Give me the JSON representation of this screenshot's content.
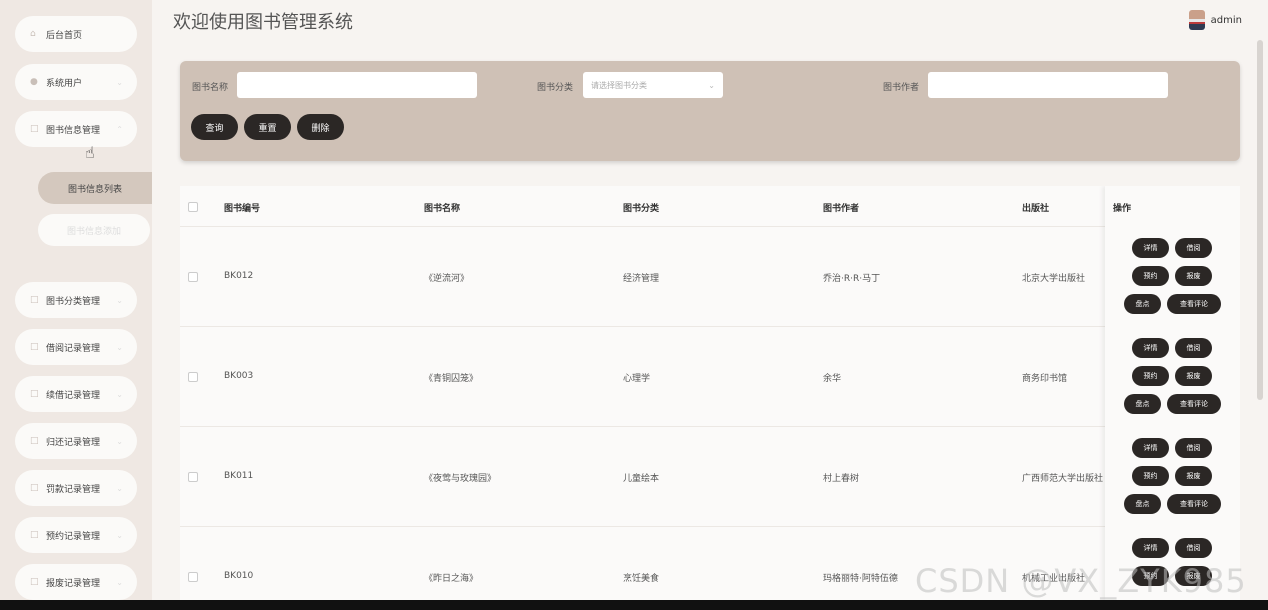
{
  "header": {
    "title": "欢迎使用图书管理系统",
    "user": "admin"
  },
  "sidebar": {
    "items": [
      {
        "label": "后台首页",
        "icon": "home-icon"
      },
      {
        "label": "系统用户",
        "icon": "user-icon"
      },
      {
        "label": "图书信息管理",
        "icon": "doc-icon"
      },
      {
        "label": "图书分类管理",
        "icon": "doc-icon"
      },
      {
        "label": "借阅记录管理",
        "icon": "doc-icon"
      },
      {
        "label": "续借记录管理",
        "icon": "doc-icon"
      },
      {
        "label": "归还记录管理",
        "icon": "doc-icon"
      },
      {
        "label": "罚款记录管理",
        "icon": "doc-icon"
      },
      {
        "label": "预约记录管理",
        "icon": "doc-icon"
      },
      {
        "label": "报废记录管理",
        "icon": "doc-icon"
      }
    ],
    "sub_items": [
      {
        "label": "图书信息列表",
        "active": true
      },
      {
        "label": "图书信息添加",
        "active": false
      }
    ]
  },
  "search": {
    "name_label": "图书名称",
    "category_label": "图书分类",
    "category_placeholder": "请选择图书分类",
    "author_label": "图书作者",
    "query_button": "查询",
    "reset_button": "重置",
    "delete_button": "删除"
  },
  "table": {
    "headers": [
      "图书编号",
      "图书名称",
      "图书分类",
      "图书作者",
      "出版社",
      "操作"
    ],
    "rows": [
      {
        "id": "BK012",
        "name": "《逆流河》",
        "category": "经济管理",
        "author": "乔治·R·R·马丁",
        "publisher": "北京大学出版社"
      },
      {
        "id": "BK003",
        "name": "《青铜囚笼》",
        "category": "心理学",
        "author": "余华",
        "publisher": "商务印书馆"
      },
      {
        "id": "BK011",
        "name": "《夜莺与玫瑰园》",
        "category": "儿童绘本",
        "author": "村上春树",
        "publisher": "广西师范大学出版社"
      },
      {
        "id": "BK010",
        "name": "《昨日之海》",
        "category": "烹饪美食",
        "author": "玛格丽特·阿特伍德",
        "publisher": "机械工业出版社"
      }
    ],
    "actions": {
      "detail": "详情",
      "borrow": "借阅",
      "reserve": "预约",
      "scrap": "报废",
      "inventory": "盘点",
      "comments": "查看评论"
    }
  },
  "watermark": "CSDN @VX_ZYK985",
  "colors": {
    "accent": "#2b2725",
    "panel": "#cfc1b6",
    "sidebar": "#efe8e3"
  }
}
